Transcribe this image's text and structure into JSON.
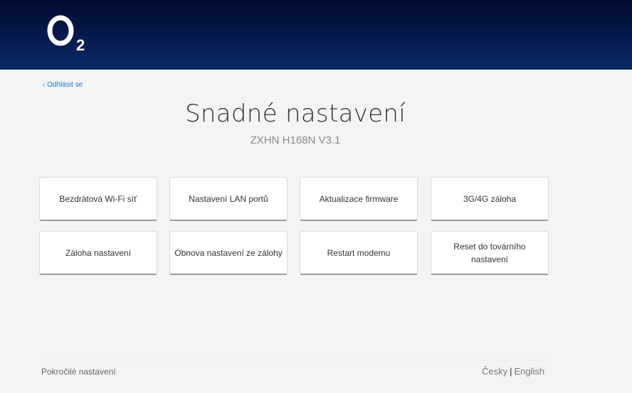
{
  "brand": {
    "logo_icon": "o2-logo-icon"
  },
  "nav": {
    "logout": "‹ Odhlásit se"
  },
  "page": {
    "title": "Snadné nastavení",
    "subtitle": "ZXHN H168N V3.1"
  },
  "tiles": [
    {
      "label": "Bezdrátová Wi-Fi síť"
    },
    {
      "label": "Nastavení LAN portů"
    },
    {
      "label": "Aktualizace firmware"
    },
    {
      "label": "3G/4G záloha"
    },
    {
      "label": "Záloha nastavení"
    },
    {
      "label": "Obnova nastavení ze zálohy"
    },
    {
      "label": "Restart modemu"
    },
    {
      "label": "Reset do továrního nastavení"
    }
  ],
  "footer": {
    "advanced": "Pokročilé nastavení",
    "lang_czech": "Česky",
    "lang_separator": "|",
    "lang_english": "English"
  },
  "colors": {
    "header_dark": "#000a2e",
    "header_light": "#0d2a66",
    "link": "#1a73c9",
    "background": "#f4f4f4"
  }
}
